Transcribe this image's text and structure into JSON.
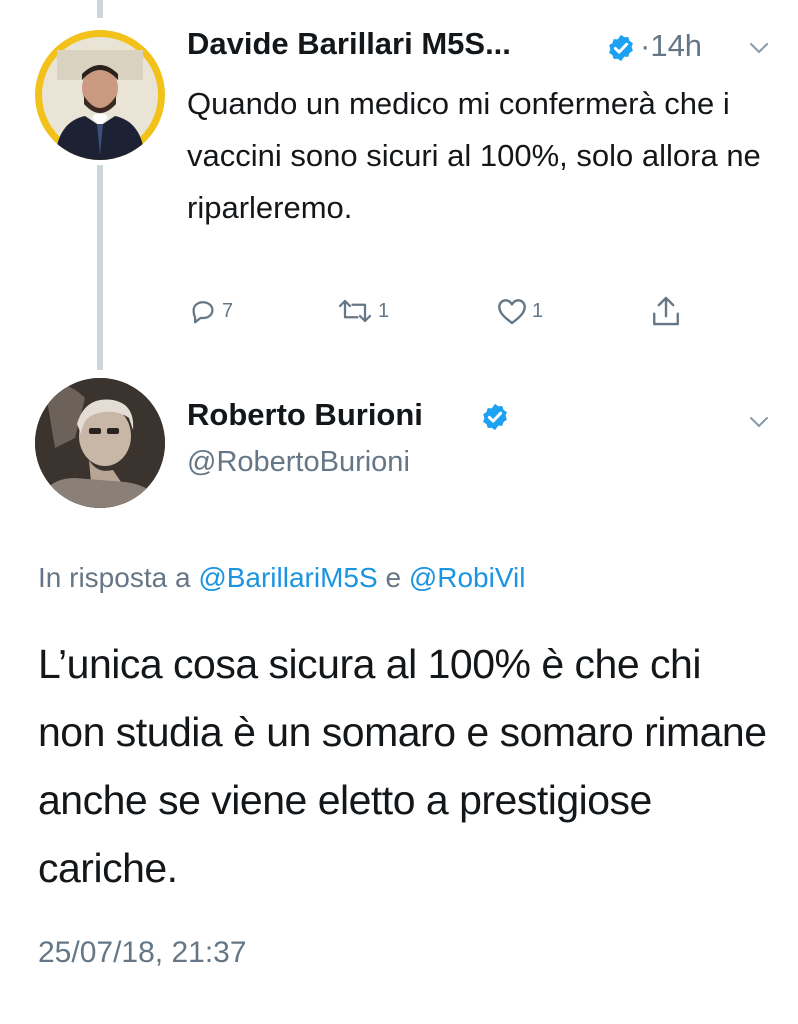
{
  "parent_tweet": {
    "display_name": "Davide Barillari M5S...",
    "separator": "·",
    "time": "14h",
    "text": "Quando un medico mi confermerà che i vaccini sono sicuri al 100%, solo allora ne riparleremo.",
    "replies": "7",
    "retweets": "1",
    "likes": "1"
  },
  "main_tweet": {
    "display_name": "Roberto Burioni",
    "handle": "@RobertoBurioni",
    "reply_prefix": "In risposta a",
    "reply_to_1": "@BarillariM5S",
    "reply_joiner": "e",
    "reply_to_2": "@RobiVil",
    "text": "L’unica cosa sicura al 100% è che chi non studia è un somaro e somaro rimane anche se viene eletto a prestigiose cariche.",
    "timestamp": "25/07/18, 21:37"
  },
  "colors": {
    "verified": "#1da1f2",
    "link": "#1b95e0",
    "muted": "#657786",
    "thread_line": "#ccd6dd"
  },
  "icons": [
    "reply-icon",
    "retweet-icon",
    "like-icon",
    "share-icon",
    "verified-badge-icon",
    "chevron-down-icon"
  ]
}
